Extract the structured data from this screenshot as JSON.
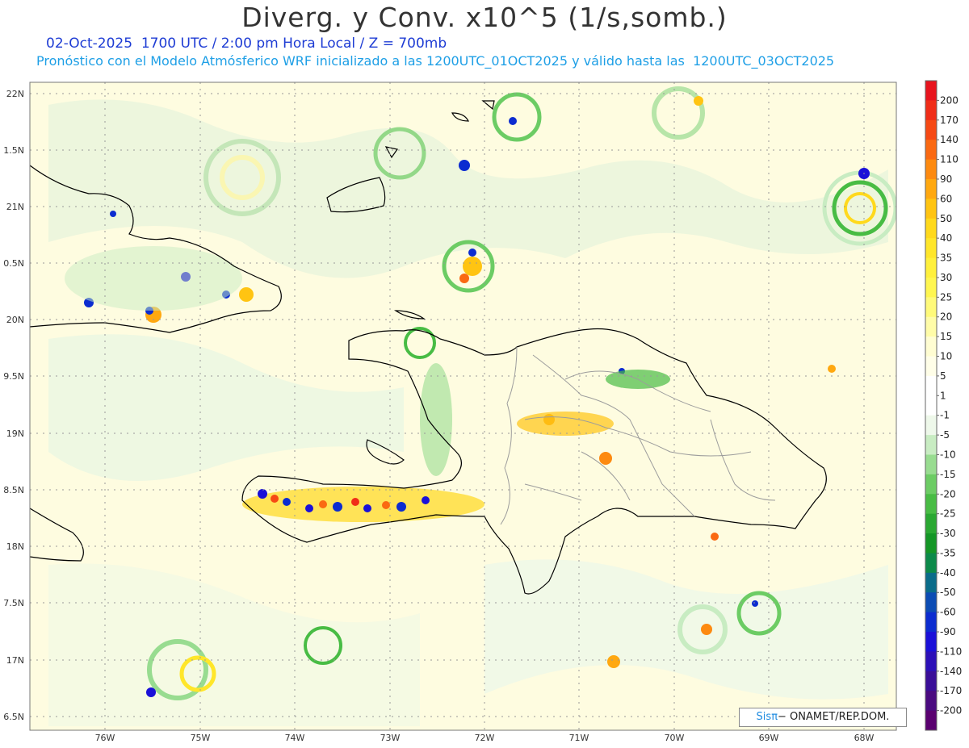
{
  "header": {
    "title": "Diverg. y Conv. x10^5 (1/s,somb.)",
    "subtitle_line1": "02-Oct-2025  1700 UTC / 2:00 pm Hora Local / Z = 700mb",
    "subtitle_line2": "Pronóstico con el Modelo Atmósferico WRF inicializado a las 1200UTC_01OCT2025 y válido hasta las  1200UTC_03OCT2025"
  },
  "axes": {
    "lat_labels": [
      "22N",
      "1.5N",
      "21N",
      "0.5N",
      "20N",
      "9.5N",
      "19N",
      "8.5N",
      "18N",
      "7.5N",
      "17N",
      "6.5N"
    ],
    "lon_labels": [
      "76W",
      "75W",
      "74W",
      "73W",
      "72W",
      "71W",
      "70W",
      "69W",
      "68W"
    ]
  },
  "colorbar": {
    "labels": [
      "200",
      "170",
      "140",
      "110",
      "90",
      "60",
      "50",
      "40",
      "35",
      "30",
      "25",
      "20",
      "15",
      "10",
      "5",
      "1",
      "-1",
      "-5",
      "-10",
      "-15",
      "-20",
      "-25",
      "-30",
      "-35",
      "-40",
      "-50",
      "-60",
      "-90",
      "-110",
      "-140",
      "-170",
      "-200"
    ],
    "colors": [
      "#e8141e",
      "#f02d18",
      "#f64914",
      "#fa6912",
      "#fd8a10",
      "#ffa810",
      "#ffc412",
      "#ffd91c",
      "#ffe62a",
      "#fff03c",
      "#fff650",
      "#fffa7a",
      "#fffca8",
      "#fffdd2",
      "#fffee8",
      "#ffffff",
      "#ffffff",
      "#eef8ea",
      "#c8ecc2",
      "#98dc90",
      "#6ccc64",
      "#48bc44",
      "#2aa832",
      "#149626",
      "#0c8a4a",
      "#0a6c8a",
      "#0c4cb4",
      "#0c2cd0",
      "#1a10d8",
      "#2c10b8",
      "#3a0e98",
      "#4a0a80",
      "#5a0070"
    ]
  },
  "credit": {
    "sis": "Sis",
    "pi": "π",
    "rest": "− ONAMET/REP.DOM."
  },
  "colors": {
    "title": "#333333",
    "subtitle1": "#1e3cd4",
    "subtitle2": "#1e9fe6"
  }
}
